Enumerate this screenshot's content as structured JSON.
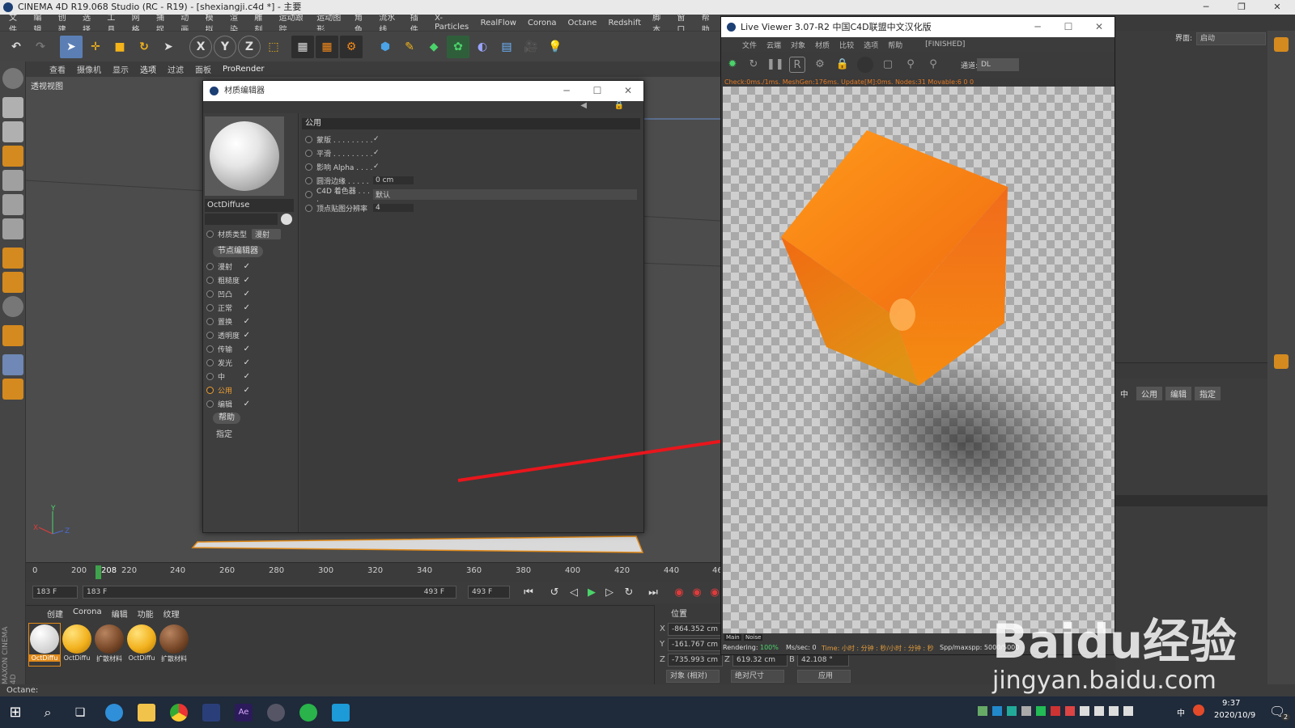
{
  "app": {
    "title": "CINEMA 4D R19.068 Studio (RC - R19) - [shexiangji.c4d *] - 主要",
    "layout_label": "界面:",
    "layout_value": "启动"
  },
  "menubar": [
    "文件",
    "编辑",
    "创建",
    "选择",
    "工具",
    "网格",
    "捕捉",
    "动画",
    "模拟",
    "渲染",
    "雕刻",
    "运动跟踪",
    "运动图形",
    "角色",
    "流水线",
    "插件",
    "X-Particles",
    "RealFlow",
    "Corona",
    "Octane",
    "Redshift",
    "脚本",
    "窗口",
    "帮助"
  ],
  "viewport": {
    "tabs": [
      "查看",
      "摄像机",
      "显示",
      "选项",
      "过滤",
      "面板",
      "ProRender"
    ],
    "label": "透视视图",
    "axis_x": "X",
    "axis_y": "Y",
    "axis_z": "Z"
  },
  "timeline": {
    "ticks": [
      "0",
      "200",
      "208",
      "220",
      "240",
      "260",
      "280",
      "300",
      "320",
      "340",
      "360",
      "380",
      "400",
      "420",
      "440",
      "46"
    ],
    "current_frame": 208,
    "start_field": "183 F",
    "range_left": "183 F",
    "range_right": "493 F",
    "end_field": "493 F"
  },
  "material_panel": {
    "tabs": [
      "创建",
      "Corona",
      "编辑",
      "功能",
      "纹理"
    ],
    "materials": [
      {
        "label": "OctDiffu",
        "color": "#f0f0f0"
      },
      {
        "label": "OctDiffu",
        "color": "#f2b21f"
      },
      {
        "label": "扩散材料",
        "color": "#7a4a2a"
      },
      {
        "label": "OctDiffu",
        "color": "#f2b21f"
      },
      {
        "label": "扩散材料",
        "color": "#7a4a2a"
      }
    ]
  },
  "coords": {
    "header": "位置",
    "x_label": "X",
    "x_value": "-864.352 cm",
    "y_label": "Y",
    "y_value": "-161.767 cm",
    "z_label": "Z",
    "z_value": "-735.993 cm",
    "z2_label": "Z",
    "z2_value": "619.32 cm",
    "b_label": "B",
    "b_value": "42.108 °",
    "mode1": "对象 (相对)",
    "mode2": "绝对尺寸",
    "apply": "应用"
  },
  "status": "Octane:",
  "material_editor": {
    "title": "材质编辑器",
    "material_name": "OctDiffuse",
    "type_label": "材质类型",
    "type_value": "漫射",
    "node_editor": "节点编辑器",
    "channels": [
      "漫射",
      "粗糙度",
      "凹凸",
      "正常",
      "置换",
      "透明度",
      "传输",
      "发光",
      "中",
      "公用",
      "编辑"
    ],
    "help": "帮助",
    "assign": "指定",
    "section": "公用",
    "props": [
      {
        "label": "蒙版 . . . . . . . . .",
        "value": "✓"
      },
      {
        "label": "平滑 . . . . . . . . .",
        "value": "✓"
      },
      {
        "label": "影响 Alpha . . . .",
        "value": "✓"
      },
      {
        "label": "圆滑边缘 . . . . .",
        "value": "0 cm"
      },
      {
        "label": "C4D 着色器 . . . .",
        "value": "默认"
      },
      {
        "label": "顶点贴图分辨率",
        "value": "4"
      }
    ]
  },
  "live_viewer": {
    "title": "Live Viewer 3.07-R2 中国C4D联盟中文汉化版",
    "menu": [
      "文件",
      "云端",
      "对象",
      "材质",
      "比较",
      "选项",
      "帮助"
    ],
    "finished": "[FINISHED]",
    "channel_label": "通道:",
    "channel_value": "DL",
    "info": "Check:0ms./1ms. MeshGen:176ms. Update[M]:0ms. Nodes:31 Movable:6  0 0",
    "tab_main": "Main",
    "tab_noise": "Noise",
    "rendering_label": "Rendering:",
    "rendering_value": "100%",
    "mssec": "Ms/sec: 0",
    "time": "Time: 小时 : 分钟 : 秒/小时 : 分钟 : 秒",
    "spp": "Spp/maxspp: 5000/5000"
  },
  "right_panel": {
    "tabs": [
      "中",
      "公用",
      "编辑",
      "指定"
    ]
  },
  "taskbar": {
    "time": "9:37",
    "date": "2020/10/9",
    "lang": "中",
    "notification_count": "2"
  },
  "watermark": {
    "brand": "Baidu经验",
    "url": "jingyan.baidu.com"
  },
  "colors": {
    "accent_orange": "#f0801a",
    "arrow_red": "#e8161c",
    "timeline_green": "#3fa34d"
  }
}
